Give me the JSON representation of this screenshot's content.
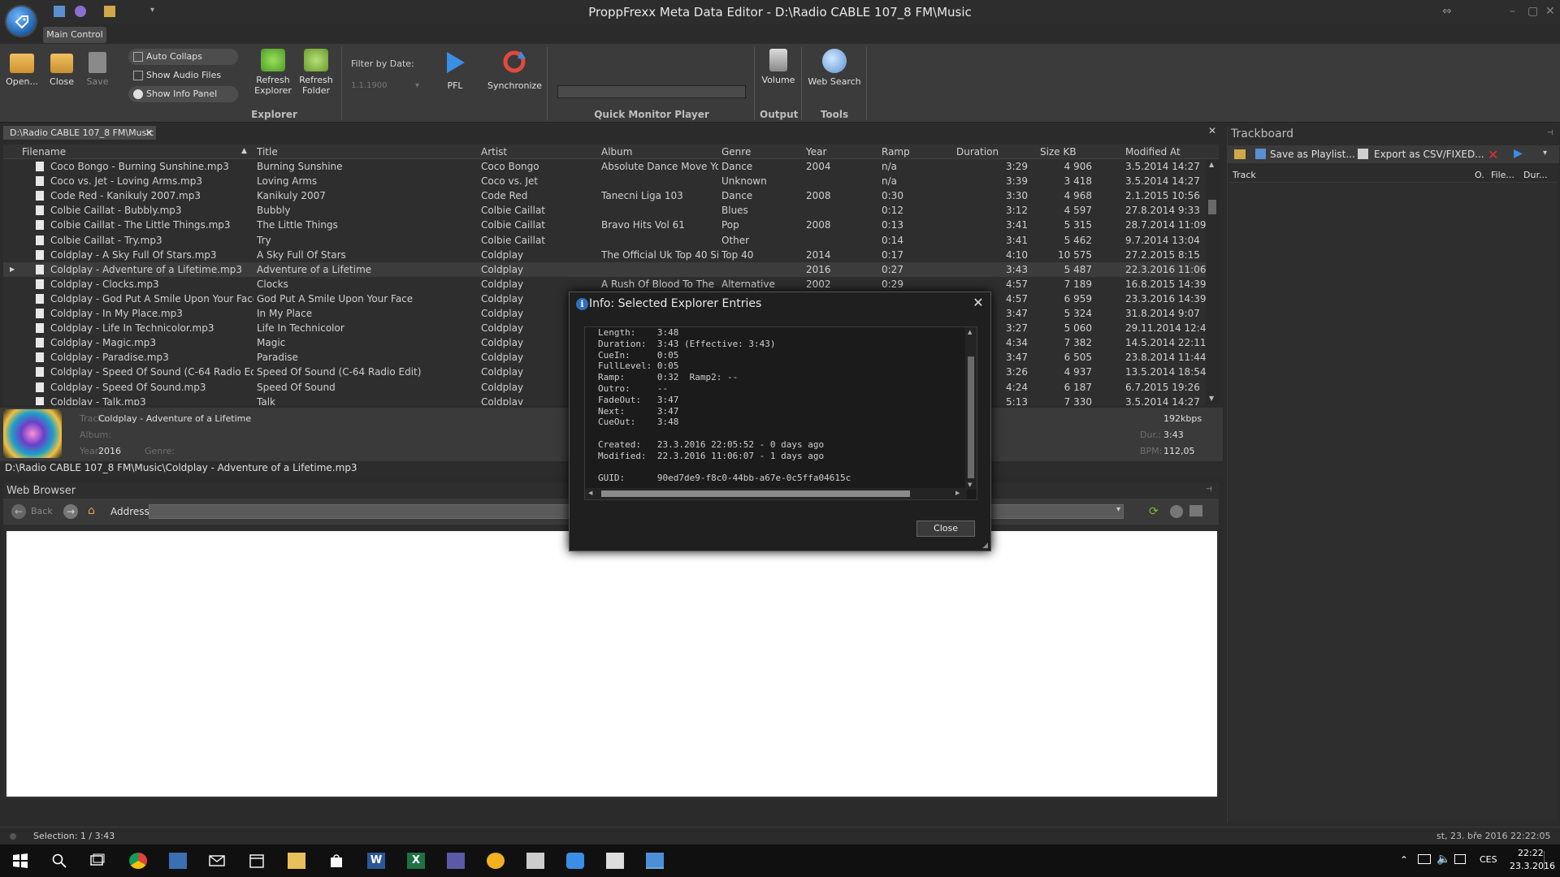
{
  "window": {
    "title": "ProppFrexx Meta Data Editor - D:\\Radio CABLE 107_8 FM\\Music",
    "ribbon_tab": "Main Control"
  },
  "ribbon": {
    "open": "Open...",
    "close": "Close",
    "save": "Save",
    "auto_collaps": "Auto Collaps",
    "show_audio_only": "Show Audio Files Only",
    "show_info_panel": "Show Info Panel",
    "refresh_explorer_1": "Refresh",
    "refresh_explorer_2": "Explorer",
    "refresh_folder_1": "Refresh",
    "refresh_folder_2": "Folder",
    "filter_by_date": "Filter by Date:",
    "filter_date_value": "1.1.1900",
    "pfl": "PFL",
    "synchronize": "Synchronize",
    "volume": "Volume",
    "web_search": "Web Search",
    "group_explorer": "Explorer",
    "group_monitor": "Quick Monitor Player",
    "group_output": "Output",
    "group_tools": "Tools"
  },
  "path_tab": "D:\\Radio CABLE 107_8 FM\\Music",
  "grid": {
    "columns": [
      "Filename",
      "Title",
      "Artist",
      "Album",
      "Genre",
      "Year",
      "Ramp",
      "Duration",
      "Size KB",
      "Modified At"
    ],
    "rows": [
      [
        "Coco Bongo - Burning Sunshine.mp3",
        "Burning Sunshine",
        "Coco Bongo",
        "Absolute Dance Move Yo...",
        "Dance",
        "2004",
        "n/a",
        "3:29",
        "4 906",
        "3.5.2014 14:27"
      ],
      [
        "Coco vs. Jet - Loving Arms.mp3",
        "Loving Arms",
        "Coco vs. Jet",
        "",
        "Unknown",
        "",
        "n/a",
        "3:39",
        "3 418",
        "3.5.2014 14:27"
      ],
      [
        "Code Red - Kanikuly 2007.mp3",
        "Kanikuly 2007",
        "Code Red",
        "Tanecni Liga 103",
        "Dance",
        "2008",
        "0:30",
        "3:30",
        "4 968",
        "2.1.2015 10:56"
      ],
      [
        "Colbie Caillat - Bubbly.mp3",
        "Bubbly",
        "Colbie Caillat",
        "",
        "Blues",
        "",
        "0:12",
        "3:12",
        "4 597",
        "27.8.2014 9:33"
      ],
      [
        "Colbie Caillat - The Little Things.mp3",
        "The Little Things",
        "Colbie Caillat",
        "Bravo Hits Vol 61",
        "Pop",
        "2008",
        "0:13",
        "3:41",
        "5 315",
        "28.7.2014 11:09"
      ],
      [
        "Colbie Caillat - Try.mp3",
        "Try",
        "Colbie Caillat",
        "",
        "Other",
        "",
        "0:14",
        "3:41",
        "5 462",
        "9.7.2014 13:04"
      ],
      [
        "Coldplay - A Sky Full Of Stars.mp3",
        "A Sky Full Of Stars",
        "Coldplay",
        "The Official Uk Top 40 Si...",
        "Top 40",
        "2014",
        "0:17",
        "4:10",
        "10 575",
        "27.2.2015 8:15"
      ],
      [
        "Coldplay - Adventure of a Lifetime.mp3",
        "Adventure of a Lifetime",
        "Coldplay",
        "",
        "",
        "2016",
        "0:27",
        "3:43",
        "5 487",
        "22.3.2016 11:06"
      ],
      [
        "Coldplay - Clocks.mp3",
        "Clocks",
        "Coldplay",
        "A Rush Of Blood To The ...",
        "Alternative",
        "2002",
        "0:29",
        "4:57",
        "7 189",
        "16.8.2015 14:39"
      ],
      [
        "Coldplay - God Put A Smile Upon Your Face....",
        "God Put A Smile Upon Your Face",
        "Coldplay",
        "",
        "",
        "",
        "",
        "4:57",
        "6 959",
        "23.3.2016 14:39"
      ],
      [
        "Coldplay - In My Place.mp3",
        "In My Place",
        "Coldplay",
        "",
        "",
        "",
        "",
        "3:47",
        "5 324",
        "31.8.2014 9:07"
      ],
      [
        "Coldplay - Life In Technicolor.mp3",
        "Life In Technicolor",
        "Coldplay",
        "",
        "",
        "",
        "",
        "3:27",
        "5 060",
        "29.11.2014 12:48"
      ],
      [
        "Coldplay - Magic.mp3",
        "Magic",
        "Coldplay",
        "",
        "",
        "",
        "",
        "4:34",
        "7 382",
        "14.5.2014 22:11"
      ],
      [
        "Coldplay - Paradise.mp3",
        "Paradise",
        "Coldplay",
        "",
        "",
        "",
        "",
        "3:47",
        "6 505",
        "23.8.2014 11:44"
      ],
      [
        "Coldplay - Speed Of Sound (C-64 Radio Edit)...",
        "Speed Of Sound (C-64 Radio Edit)",
        "Coldplay",
        "",
        "",
        "",
        "",
        "3:26",
        "4 937",
        "13.5.2014 18:54"
      ],
      [
        "Coldplay - Speed Of Sound.mp3",
        "Speed Of Sound",
        "Coldplay",
        "",
        "",
        "",
        "",
        "4:24",
        "6 187",
        "6.7.2015 19:26"
      ],
      [
        "Coldplay - Talk.mp3",
        "Talk",
        "Coldplay",
        "",
        "",
        "",
        "",
        "5:13",
        "7 330",
        "3.5.2014 14:27"
      ]
    ]
  },
  "info_strip": {
    "track_label": "Track:",
    "track_value": "Coldplay - Adventure of a Lifetime",
    "album_label": "Album:",
    "year_label": "Year:",
    "year_value": "2016",
    "genre_label": "Genre:",
    "bitrate": "192kbps",
    "dur_label": "Dur.:",
    "dur_value": "3:43",
    "bpm_label": "BPM:",
    "bpm_value": "112,05"
  },
  "path_line": "D:\\Radio CABLE 107_8 FM\\Music\\Coldplay - Adventure of a Lifetime.mp3",
  "web_browser": {
    "title": "Web Browser",
    "back": "Back",
    "address_label": "Address"
  },
  "trackboard": {
    "title": "Trackboard",
    "save_playlist": "Save as Playlist...",
    "export_csv": "Export as CSV/FIXED...",
    "col_track": "Track",
    "col_o": "O.",
    "col_file": "File...",
    "col_dur": "Dur..."
  },
  "dialog": {
    "title": "Info: Selected Explorer Entries",
    "lines": [
      "Length:    3:48",
      "Duration:  3:43 (Effective: 3:43)",
      "CueIn:     0:05",
      "FullLevel: 0:05",
      "Ramp:      0:32  Ramp2: --",
      "Outro:     --",
      "FadeOut:   3:47",
      "Next:      3:47",
      "CueOut:    3:48",
      "",
      "Created:   23.3.2016 22:05:52 - 0 days ago",
      "Modified:  22.3.2016 11:06:07 - 1 days ago",
      "",
      "GUID:      90ed7de9-f8c0-44bb-a67e-0c5ffa04615c"
    ],
    "close_button": "Close"
  },
  "status": {
    "selection": "Selection: 1 / 3:43",
    "datetime": "st, 23. bře 2016 22:22:05"
  },
  "taskbar": {
    "lang": "CES",
    "time": "22:22",
    "date": "23.3.2016"
  },
  "colors": {
    "background": "#2b2b2b",
    "ribbon": "#3b3b3b",
    "accent_blue": "#3a8ee6",
    "sync_red": "#e24a3a",
    "refresh_green": "#6fbf3a"
  }
}
